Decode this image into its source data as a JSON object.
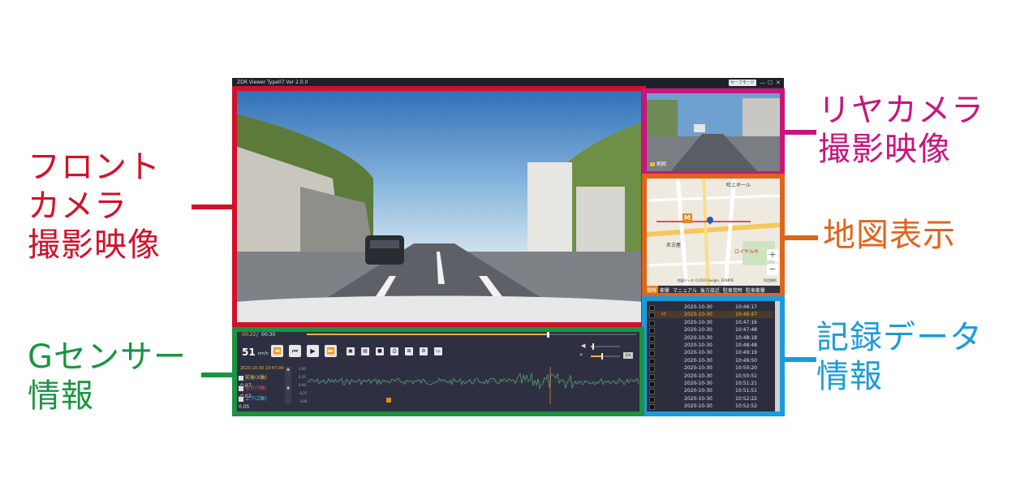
{
  "callouts": {
    "front": "フロント\nカメラ\n撮影映像",
    "rear": "リヤカメラ\n撮影映像",
    "map": "地図表示",
    "gsensor": "Gセンサー\n情報",
    "records": "記録データ\n情報"
  },
  "colors": {
    "front": "#d2102a",
    "rear": "#c8157e",
    "map": "#e0641b",
    "gsensor": "#1a9440",
    "records": "#1a9cdc"
  },
  "app": {
    "title": "ZDR Viewer Type07 Ver 2.0.0",
    "safe_mode": "セーフモード",
    "minimize": "—",
    "maximize": "☐",
    "close": "✕"
  },
  "rear": {
    "label": "地図"
  },
  "map": {
    "place1": "吹上ホール",
    "place2": "名古屋",
    "place3": "ロイヤルホ",
    "attribution": "地図データ ©2019 Google, ZENRIN",
    "terms": "利用規約",
    "zoom_in": "+",
    "zoom_out": "−",
    "tabs": [
      "常時",
      "衝撃",
      "マニュアル",
      "後方接近",
      "駐車常時",
      "駐車衝撃"
    ]
  },
  "records": {
    "rows": [
      {
        "date": "2020-10-30",
        "time": "10:46:17",
        "marker": ""
      },
      {
        "date": "2020-10-30",
        "time": "10:46:47",
        "marker": "M"
      },
      {
        "date": "2020-10-30",
        "time": "10:47:16",
        "marker": ""
      },
      {
        "date": "2020-10-30",
        "time": "10:47:48",
        "marker": ""
      },
      {
        "date": "2020-10-30",
        "time": "10:48:18",
        "marker": ""
      },
      {
        "date": "2020-10-30",
        "time": "10:48:48",
        "marker": ""
      },
      {
        "date": "2020-10-30",
        "time": "10:49:19",
        "marker": ""
      },
      {
        "date": "2020-10-30",
        "time": "10:49:50",
        "marker": ""
      },
      {
        "date": "2020-10-30",
        "time": "10:50:20",
        "marker": ""
      },
      {
        "date": "2020-10-30",
        "time": "10:50:51",
        "marker": ""
      },
      {
        "date": "2020-10-30",
        "time": "10:51:21",
        "marker": ""
      },
      {
        "date": "2020-10-30",
        "time": "10:51:51",
        "marker": ""
      },
      {
        "date": "2020-10-30",
        "time": "10:52:22",
        "marker": ""
      },
      {
        "date": "2020-10-30",
        "time": "10:52:52",
        "marker": ""
      }
    ]
  },
  "player": {
    "elapsed": "00:22",
    "separator": "/",
    "total": "00:30",
    "progress": 0.73,
    "speed": "51",
    "speed_unit": "km/h",
    "timestamp": "2020-10-30 10:47:09",
    "rate": "1×",
    "volume": 0.05,
    "playback_speed": 0.35
  },
  "gsensor": {
    "axes": [
      {
        "label": "前後(X軸)",
        "value": "-0.07",
        "color": "#e8c24a"
      },
      {
        "label": "左右(Y軸)",
        "value": "-0.02",
        "color": "#e25050"
      },
      {
        "label": "上下(Z軸)",
        "value": "0.05",
        "color": "#4fb7ea"
      }
    ],
    "ticks": [
      "3.00",
      "0.25",
      "0.00",
      "-0.25",
      "-3.00"
    ]
  }
}
